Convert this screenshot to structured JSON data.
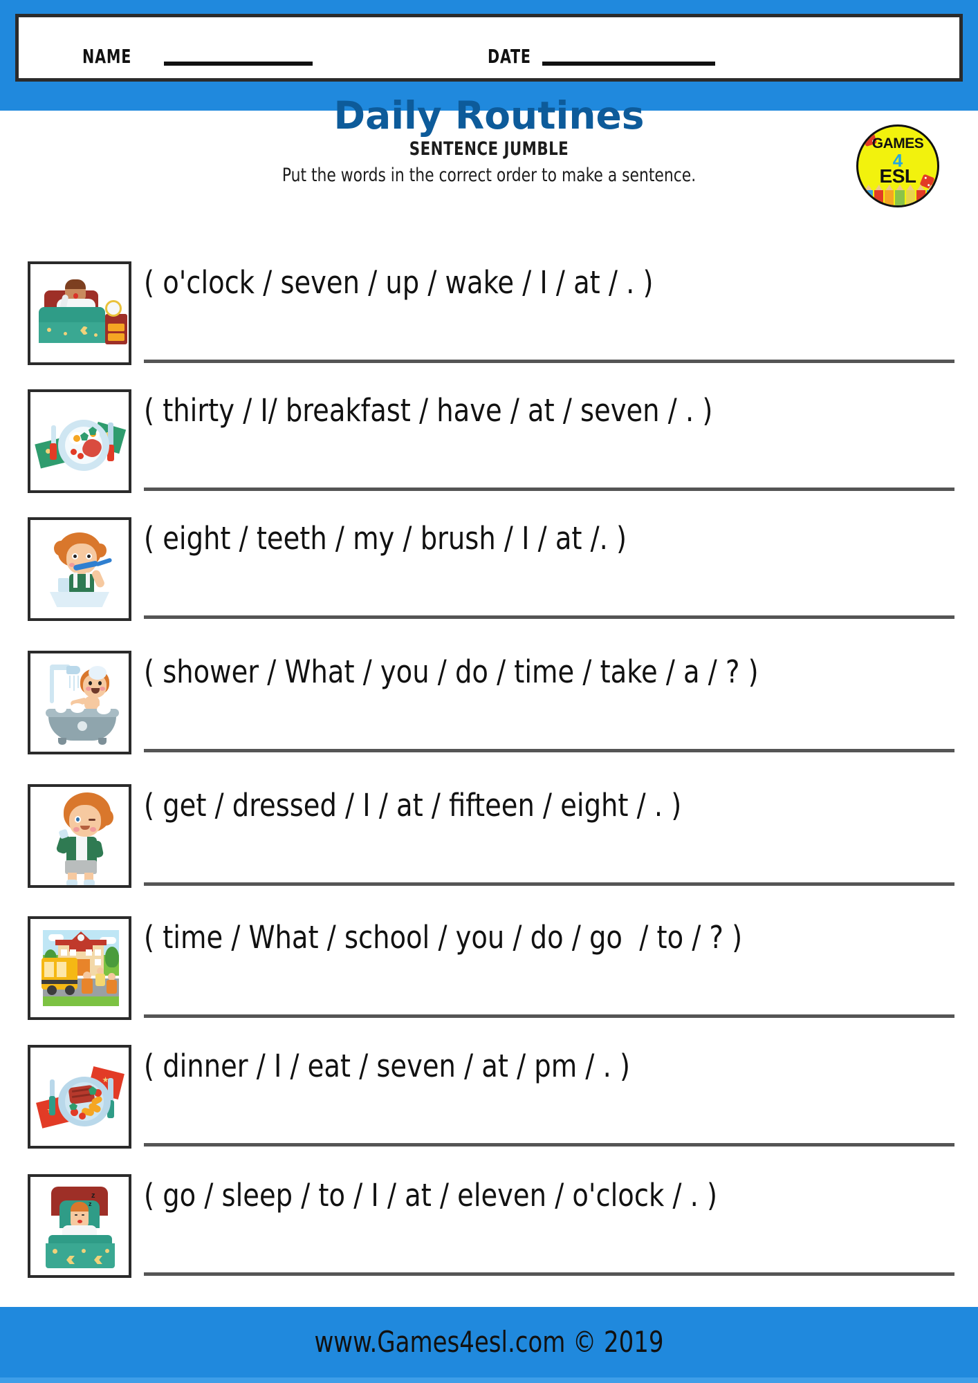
{
  "header": {
    "name_label": "NAME",
    "date_label": "DATE"
  },
  "title": "Daily Routines",
  "subtitle": "SENTENCE JUMBLE",
  "instructions": "Put the words in the correct order to make a sentence.",
  "logo": {
    "line1": "GAMES",
    "line2": "4",
    "line3": "ESL"
  },
  "colors": {
    "band_blue": "#2089dd",
    "title_blue": "#0d5b9a",
    "logo_yellow": "#f2f20d",
    "line_gray": "#555555",
    "border_dark": "#2b2b2b"
  },
  "questions": [
    {
      "image": "wake-up-in-bed-icon",
      "sentence": "( o'clock / seven / up / wake / I / at / . )"
    },
    {
      "image": "breakfast-plate-icon",
      "sentence": "( thirty / I/ breakfast / have / at / seven / . )"
    },
    {
      "image": "brush-teeth-boy-icon",
      "sentence": "( eight / teeth / my / brush / I / at /. )"
    },
    {
      "image": "take-shower-bathtub-icon",
      "sentence": "( shower / What / you / do / time / take / a / ? )"
    },
    {
      "image": "get-dressed-boy-icon",
      "sentence": "( get / dressed / I / at / fifteen / eight / . )"
    },
    {
      "image": "school-bus-building-icon",
      "sentence": "( time / What / school / you / do / go  / to / ? )"
    },
    {
      "image": "dinner-plate-icon",
      "sentence": "( dinner / I / eat / seven / at / pm / . )"
    },
    {
      "image": "go-to-sleep-bed-icon",
      "sentence": "( go / sleep / to / I / at / eleven / o'clock / . )"
    }
  ],
  "footer": {
    "text": "www.Games4esl.com © 2019"
  }
}
